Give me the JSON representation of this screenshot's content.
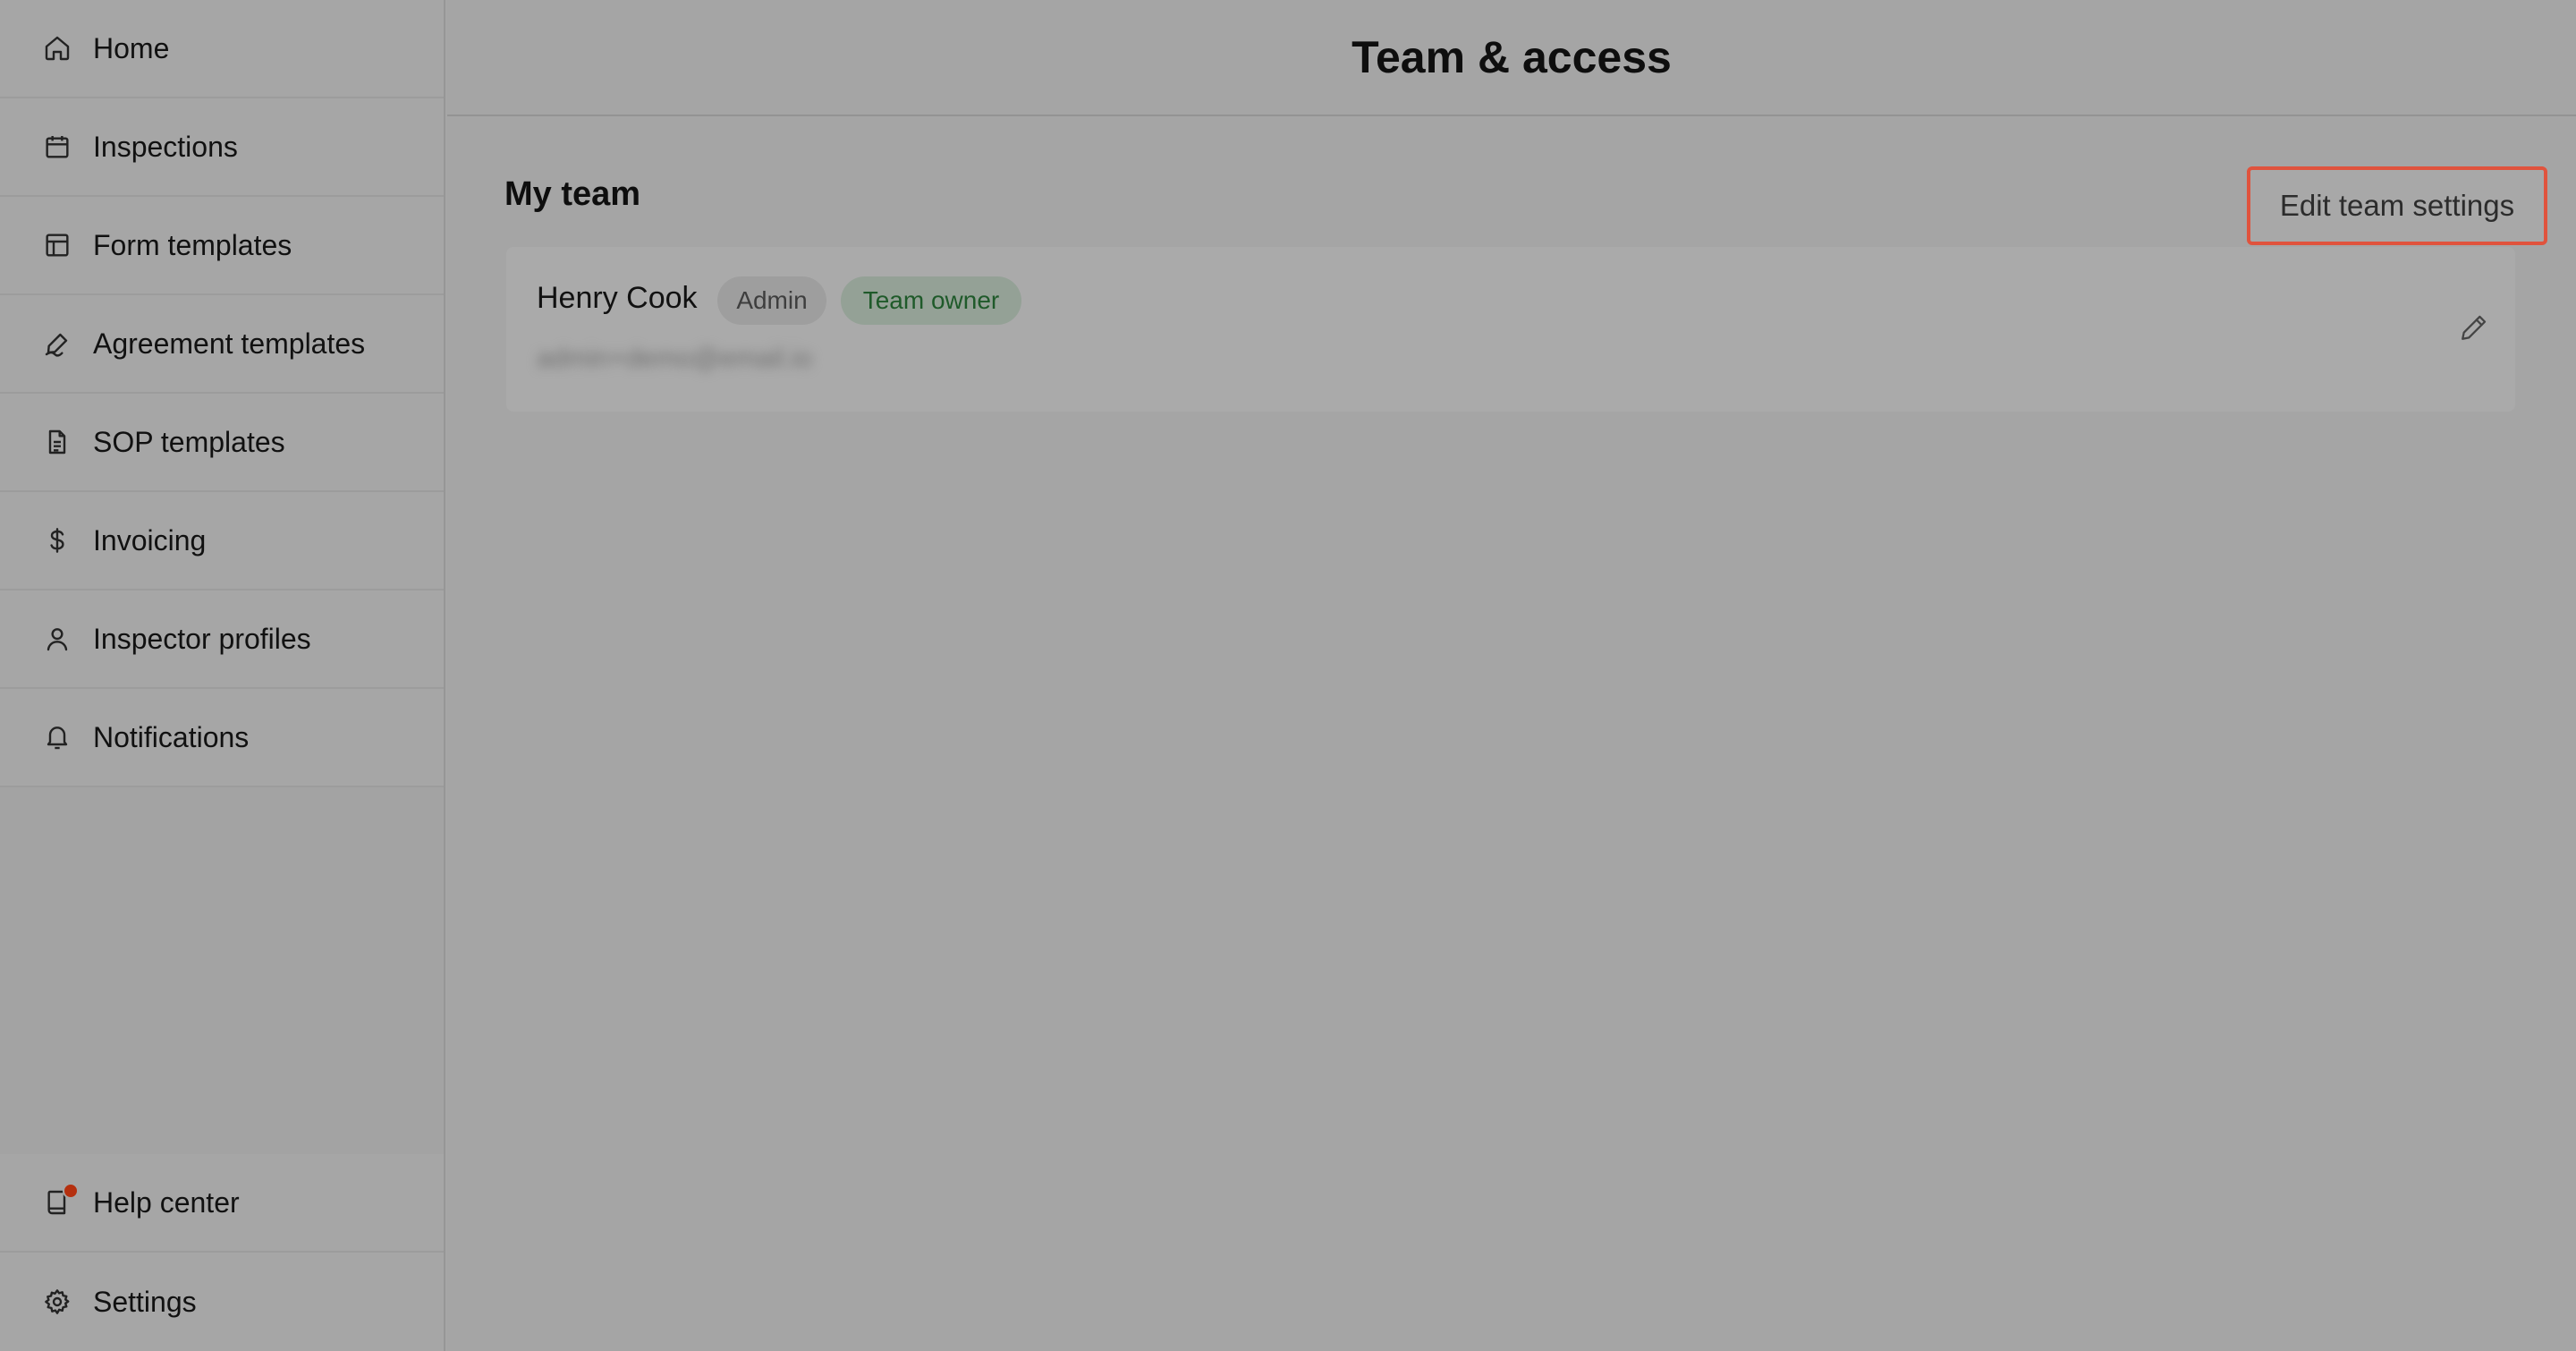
{
  "sidebar": {
    "items": [
      {
        "label": "Home",
        "icon": "home-icon"
      },
      {
        "label": "Inspections",
        "icon": "calendar-icon"
      },
      {
        "label": "Form templates",
        "icon": "layout-icon"
      },
      {
        "label": "Agreement templates",
        "icon": "signature-icon"
      },
      {
        "label": "SOP templates",
        "icon": "document-icon"
      },
      {
        "label": "Invoicing",
        "icon": "dollar-icon"
      },
      {
        "label": "Inspector profiles",
        "icon": "user-icon"
      },
      {
        "label": "Notifications",
        "icon": "bell-icon"
      }
    ],
    "bottom_items": [
      {
        "label": "Help center",
        "icon": "book-icon",
        "has_notification_dot": true
      },
      {
        "label": "Settings",
        "icon": "gear-icon"
      }
    ]
  },
  "header": {
    "title": "Team & access"
  },
  "team": {
    "section_title": "My team",
    "edit_button_label": "Edit team settings",
    "members": [
      {
        "name": "Henry Cook",
        "badges": [
          "Admin",
          "Team owner"
        ],
        "email": "admin+demo@email.io"
      }
    ]
  },
  "colors": {
    "highlight_border": "#e0533d",
    "notification_dot": "#b5300f",
    "owner_badge_text": "#1f5a2a"
  }
}
